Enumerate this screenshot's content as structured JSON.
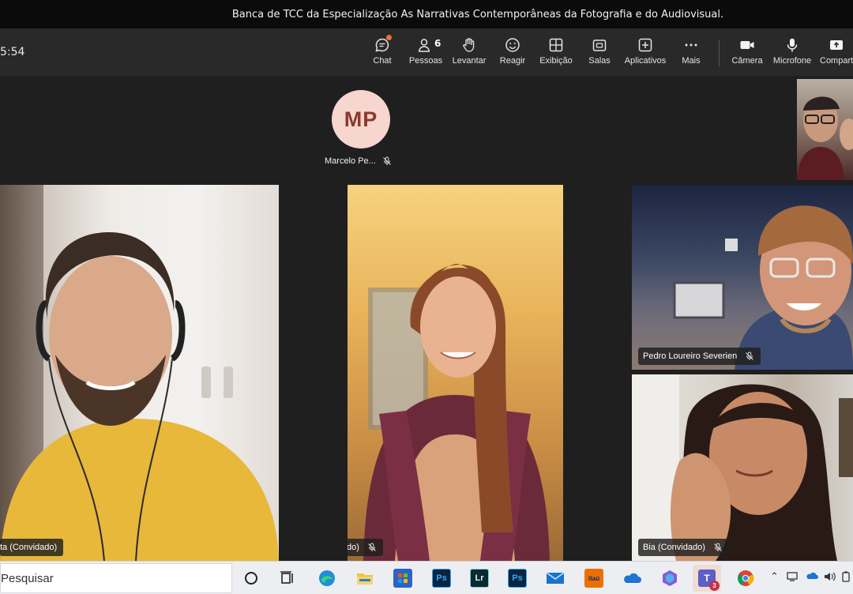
{
  "window": {
    "title": "Banca de TCC da Especialização As Narrativas Contemporâneas da Fotografia e do Audiovisual."
  },
  "toolbar": {
    "timer": "5:54",
    "buttons": [
      {
        "id": "chat",
        "label": "Chat",
        "icon": "chat-icon"
      },
      {
        "id": "people",
        "label": "Pessoas",
        "icon": "people-icon",
        "count": "6"
      },
      {
        "id": "raise",
        "label": "Levantar",
        "icon": "hand-icon"
      },
      {
        "id": "react",
        "label": "Reagir",
        "icon": "smiley-icon"
      },
      {
        "id": "view",
        "label": "Exibição",
        "icon": "grid-icon"
      },
      {
        "id": "rooms",
        "label": "Salas",
        "icon": "rooms-icon"
      },
      {
        "id": "apps",
        "label": "Aplicativos",
        "icon": "plus-square-icon"
      },
      {
        "id": "more",
        "label": "Mais",
        "icon": "ellipsis-icon"
      },
      {
        "id": "camera",
        "label": "Câmera",
        "icon": "camera-icon"
      },
      {
        "id": "mic",
        "label": "Microfone",
        "icon": "microphone-icon"
      },
      {
        "id": "share",
        "label": "Compart",
        "icon": "share-icon"
      }
    ]
  },
  "participants": {
    "avatar": {
      "initials": "MP",
      "name": "Marcelo Pe..."
    },
    "tiles": [
      {
        "name": "ta (Convidado)"
      },
      {
        "name": "Alícia (Convidado)"
      },
      {
        "name": "Pedro Loureiro Severien"
      },
      {
        "name": "Bia (Convidado)"
      }
    ]
  },
  "taskbar": {
    "search_placeholder": "Pesquisar",
    "apps": [
      {
        "icon": "cortana-circle-icon"
      },
      {
        "icon": "task-view-icon"
      },
      {
        "icon": "edge-icon"
      },
      {
        "icon": "file-explorer-icon"
      },
      {
        "icon": "microsoft-store-icon"
      },
      {
        "icon": "photoshop-icon",
        "text": "Ps"
      },
      {
        "icon": "lightroom-icon",
        "text": "Lr"
      },
      {
        "icon": "photoshop-icon",
        "text": "Ps"
      },
      {
        "icon": "mail-icon"
      },
      {
        "icon": "itau-icon",
        "text": "itaú"
      },
      {
        "icon": "onedrive-icon"
      },
      {
        "icon": "copilot-icon"
      },
      {
        "icon": "teams-icon",
        "text": "T",
        "badge": "3"
      },
      {
        "icon": "chrome-icon"
      }
    ]
  },
  "colors": {
    "accent_orange": "#e8733c",
    "avatar_bg": "#f6d6cf",
    "avatar_text": "#8a3a2d",
    "teams_purple": "#5b5fc7"
  }
}
